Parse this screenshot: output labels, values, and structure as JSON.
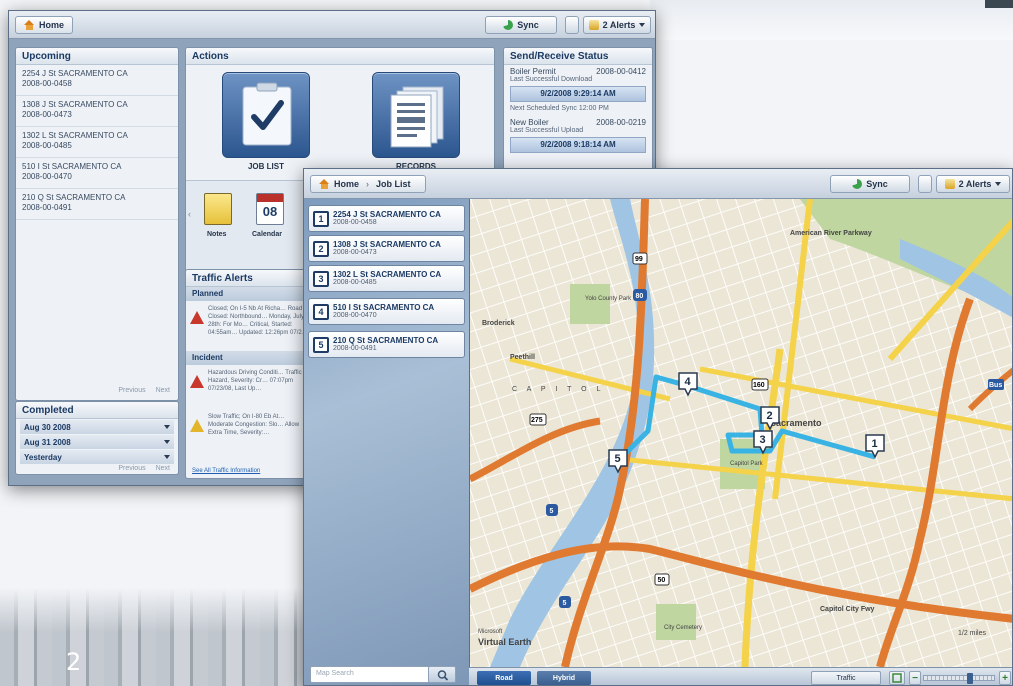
{
  "back_window": {
    "home_label": "Home",
    "sync_label": "Sync",
    "alerts_label": "2 Alerts",
    "upcoming": {
      "title": "Upcoming",
      "items": [
        {
          "address": "2254 J St SACRAMENTO CA",
          "id": "2008-00-0458"
        },
        {
          "address": "1308 J St SACRAMENTO CA",
          "id": "2008-00-0473"
        },
        {
          "address": "1302 L St SACRAMENTO CA",
          "id": "2008-00-0485"
        },
        {
          "address": "510 I St SACRAMENTO CA",
          "id": "2008-00-0470"
        },
        {
          "address": "210 Q St SACRAMENTO CA",
          "id": "2008-00-0491"
        }
      ],
      "prev": "Previous",
      "next": "Next"
    },
    "completed": {
      "title": "Completed",
      "rows": [
        "Aug 30 2008",
        "Aug 31 2008",
        "Yesterday"
      ],
      "prev": "Previous",
      "next": "Next"
    },
    "actions": {
      "title": "Actions",
      "job_list": "JOB LIST",
      "records": "RECORDS",
      "notes": "Notes",
      "calendar": "Calendar",
      "calendar_day": "08"
    },
    "traffic": {
      "title": "Traffic Alerts",
      "planned_label": "Planned",
      "incident_label": "Incident",
      "entries": [
        {
          "text": "Closed; On I-5 Nb At Richa… Road Closed: Northbound… Monday, July 28th: For Mo… Critical, Started: 04:55am… Updated: 12:26pm 07/2…",
          "level": "red"
        },
        {
          "text": "Hazardous Driving Conditi… Traffic Hazard, Severity: Cr… 07:07pm 07/23/08, Last Up…",
          "level": "red"
        },
        {
          "text": "Slow Traffic; On I-80 Eb At… Moderate Congestion: Slo… Allow Extra Time, Severity:…",
          "level": "yellow"
        }
      ],
      "link": "See All Traffic Information"
    },
    "status": {
      "title": "Send/Receive Status",
      "permit_name": "Boiler Permit",
      "permit_id": "2008-00-0412",
      "last_download_label": "Last Successful Download",
      "last_download_time": "9/2/2008 9:29:14 AM",
      "next_sync": "Next Scheduled Sync 12:00 PM",
      "new_name": "New Boiler",
      "new_id": "2008-00-0219",
      "last_upload_label": "Last Successful Upload",
      "last_upload_time": "9/2/2008 9:18:14 AM"
    }
  },
  "front_window": {
    "breadcrumb_home": "Home",
    "breadcrumb_current": "Job List",
    "sync_label": "Sync",
    "alerts_label": "2 Alerts",
    "jobs": [
      {
        "num": "1",
        "address": "2254 J St SACRAMENTO CA",
        "id": "2008-00-0458"
      },
      {
        "num": "2",
        "address": "1308 J St SACRAMENTO CA",
        "id": "2008-00-0473"
      },
      {
        "num": "3",
        "address": "1302 L St SACRAMENTO CA",
        "id": "2008-00-0485"
      },
      {
        "num": "4",
        "address": "510 I St SACRAMENTO CA",
        "id": "2008-00-0470"
      },
      {
        "num": "5",
        "address": "210 Q St SACRAMENTO CA",
        "id": "2008-00-0491"
      }
    ],
    "map_search_placeholder": "Map Search",
    "map": {
      "labels": {
        "american_river_parkway": "American River Parkway",
        "yolo_county_park": "Yolo County Park",
        "broderick": "Broderick",
        "capitol_park": "Capitol Park",
        "city": "Sacramento",
        "city_cemetery": "City Cemetery",
        "capitol_city_fwy": "Capitol City Fwy",
        "brand_small": "Microsoft",
        "brand": "Virtual Earth",
        "scale": "1/2 miles",
        "peethill": "Peethill",
        "capitol_letters": "C A P I T O L"
      },
      "pins": [
        "1",
        "2",
        "3",
        "4",
        "5"
      ],
      "shields": [
        "99",
        "80",
        "275",
        "160",
        "50",
        "5",
        "Bus"
      ]
    },
    "map_bar": {
      "road": "Road",
      "hybrid": "Hybrid",
      "traffic": "Traffic"
    }
  },
  "page_number": "2",
  "colors": {
    "route": "#38b3e3",
    "freeway": "#e07a30",
    "major_road": "#f4d24a",
    "river": "#9fc4e4",
    "park": "#bfd6a0",
    "accent_blue": "#1f4f8f"
  }
}
